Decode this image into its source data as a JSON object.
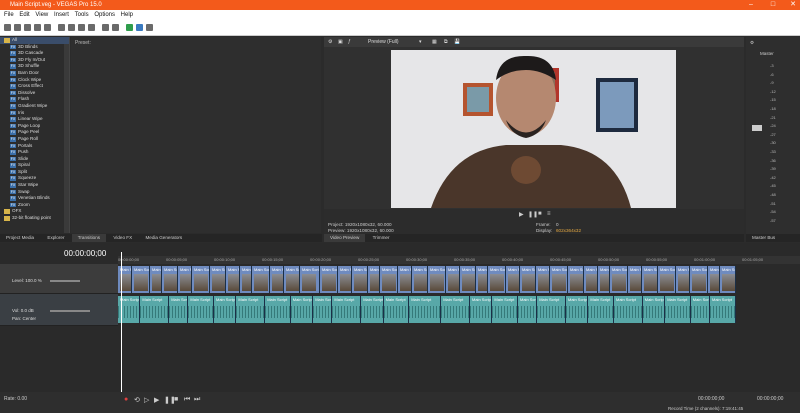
{
  "window": {
    "title": "Main Script.veg - VEGAS Pro 15.0"
  },
  "menu": [
    "File",
    "Edit",
    "View",
    "Insert",
    "Tools",
    "Options",
    "Help"
  ],
  "explorer": {
    "root": "All",
    "items": [
      "3D Blinds",
      "3D Cascade",
      "3D Fly In/Out",
      "3D Shuffle",
      "Barn Door",
      "Clock Wipe",
      "Cross Effect",
      "Dissolve",
      "Flash",
      "Gradient Wipe",
      "Iris",
      "Linear Wipe",
      "Page Loop",
      "Page Peel",
      "Page Roll",
      "Portals",
      "Push",
      "Slide",
      "Spiral",
      "Split",
      "Squeeze",
      "Star Wipe",
      "Swap",
      "Venetian Blinds",
      "Zoom"
    ],
    "folders": [
      "OFX",
      "32-bit floating point"
    ],
    "fx_label": "FX",
    "presets_label": "Preset:"
  },
  "bottom_tabs": [
    "Project Media",
    "Explorer",
    "Transitions",
    "Video FX",
    "Media Generators"
  ],
  "preview": {
    "mode": "Preview (Full)",
    "project": "Project:   1920x1080x32, 60.000",
    "preview_info": "Preview:  1920x1080x32, 60.000",
    "frame_label": "Frame:",
    "frame": "0",
    "display_label": "Display:",
    "display": "602x364x32",
    "tabs": [
      "Video Preview",
      "Trimmer"
    ]
  },
  "master": {
    "label": "Master",
    "tab": "Master Bus",
    "scale": [
      "-3",
      "-6",
      "-9",
      "-12",
      "-15",
      "-18",
      "-21",
      "-24",
      "-27",
      "-30",
      "-33",
      "-36",
      "-39",
      "-42",
      "-45",
      "-48",
      "-51",
      "-54",
      "-57"
    ]
  },
  "timeline": {
    "timecode": "00:00:00;00",
    "level": "Level: 100.0 %",
    "vol": "Vol:  0.0 dB",
    "pan": "Pan:   Center",
    "ruler": [
      "00:00:00;00",
      "00:00:05;00",
      "00:00:10;00",
      "00:00:15;00",
      "00:00:20;00",
      "00:00:25;00",
      "00:00:30;00",
      "00:00:35;00",
      "00:00:40;00",
      "00:00:45;00",
      "00:00:50;00",
      "00:00:55;00",
      "00:01:00;00",
      "00:01:05;00"
    ],
    "clip_label": "Main Scri",
    "clip_label_long": "Main Script"
  },
  "footer": {
    "rate": "Rate: 0.00",
    "rec": "Record Time (2 channels): 7:19:41:45",
    "position": "00:00:00;00",
    "end": "00:00:00;00"
  }
}
